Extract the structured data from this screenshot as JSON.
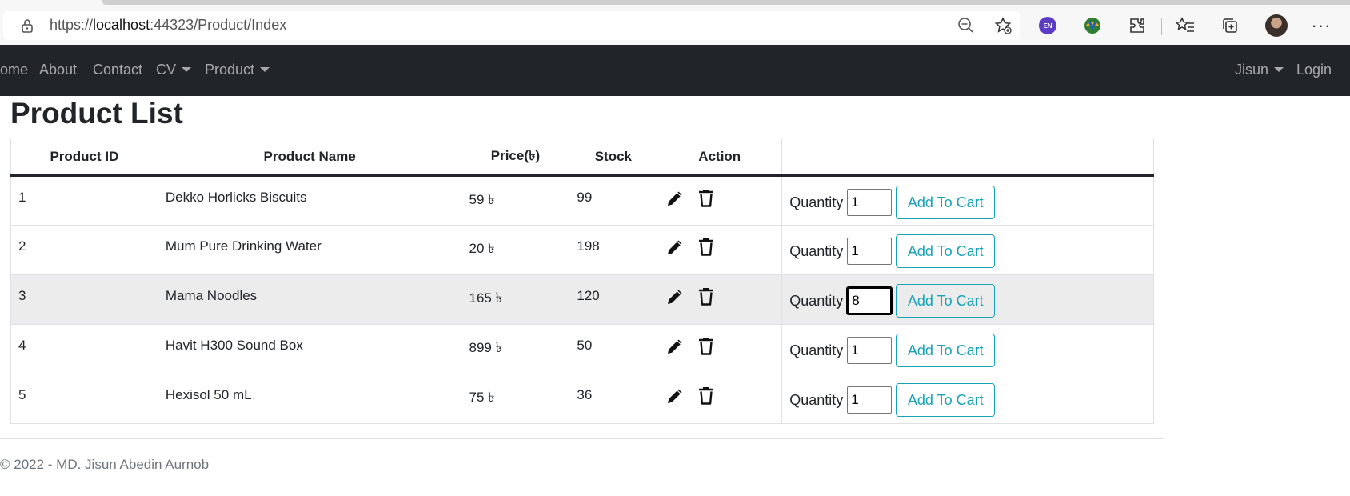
{
  "browser": {
    "url_scheme": "https://",
    "url_host": "localhost",
    "url_rest": ":44323/Product/Index",
    "language_badge": "EN",
    "icons": [
      "lock-icon",
      "zoom-out-icon",
      "add-favorite-icon",
      "language-icon",
      "download-manager-icon",
      "extensions-icon",
      "favorites-icon",
      "collections-icon",
      "profile-avatar",
      "more-icon"
    ]
  },
  "navbar": {
    "items": [
      {
        "label": "ome"
      },
      {
        "label": "About"
      },
      {
        "label": "Contact"
      },
      {
        "label": "CV"
      },
      {
        "label": "Product"
      }
    ],
    "user_label": "Jisun",
    "login_label": "Login",
    "background": "#212529"
  },
  "page": {
    "title": "Product List"
  },
  "table": {
    "headers": [
      "Product ID",
      "Product Name",
      "Price(৳)",
      "Stock",
      "Action",
      ""
    ],
    "quantity_label": "Quantity",
    "add_to_cart_label": "Add To Cart",
    "rows": [
      {
        "id": "1",
        "name": "Dekko Horlicks Biscuits",
        "price": "59 ৳",
        "stock": "99",
        "qty": "1"
      },
      {
        "id": "2",
        "name": "Mum Pure Drinking Water",
        "price": "20 ৳",
        "stock": "198",
        "qty": "1"
      },
      {
        "id": "3",
        "name": "Mama Noodles",
        "price": "165 ৳",
        "stock": "120",
        "qty": "8"
      },
      {
        "id": "4",
        "name": "Havit H300 Sound Box",
        "price": "899 ৳",
        "stock": "50",
        "qty": "1"
      },
      {
        "id": "5",
        "name": "Hexisol 50 mL",
        "price": "75 ৳",
        "stock": "36",
        "qty": "1"
      }
    ],
    "accent": "#17a2b8"
  },
  "footer": {
    "text": "© 2022 - MD. Jisun Abedin Aurnob"
  }
}
